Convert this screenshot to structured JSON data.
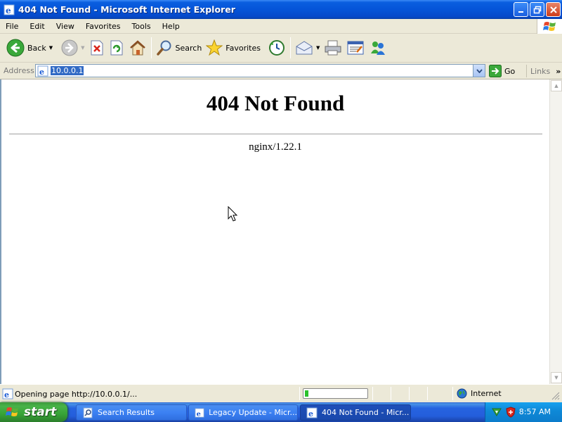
{
  "window": {
    "title": "404 Not Found - Microsoft Internet Explorer",
    "controls": {
      "minimize": "_",
      "maximize": "□",
      "close": "✕"
    }
  },
  "menu": [
    "File",
    "Edit",
    "View",
    "Favorites",
    "Tools",
    "Help"
  ],
  "toolbar": {
    "back": "Back",
    "search": "Search",
    "favorites": "Favorites"
  },
  "address": {
    "label": "Address",
    "url": "10.0.0.1",
    "go": "Go",
    "links": "Links",
    "links_chevron": "»"
  },
  "page": {
    "heading": "404 Not Found",
    "server": "nginx/1.22.1"
  },
  "status": {
    "text": "Opening page http://10.0.0.1/...",
    "progress_fraction": 0.06,
    "zone": "Internet"
  },
  "taskbar": {
    "start": "start",
    "tasks": [
      {
        "label": "Search Results",
        "active": false
      },
      {
        "label": "Legacy Update - Micr...",
        "active": false
      },
      {
        "label": "404 Not Found - Micr...",
        "active": true
      }
    ],
    "clock": "8:57 AM"
  },
  "colors": {
    "titlebar": "#0554d8",
    "chrome": "#ece9d8",
    "taskbar": "#245edb",
    "start": "#37a337",
    "tray": "#0f8ad8"
  }
}
